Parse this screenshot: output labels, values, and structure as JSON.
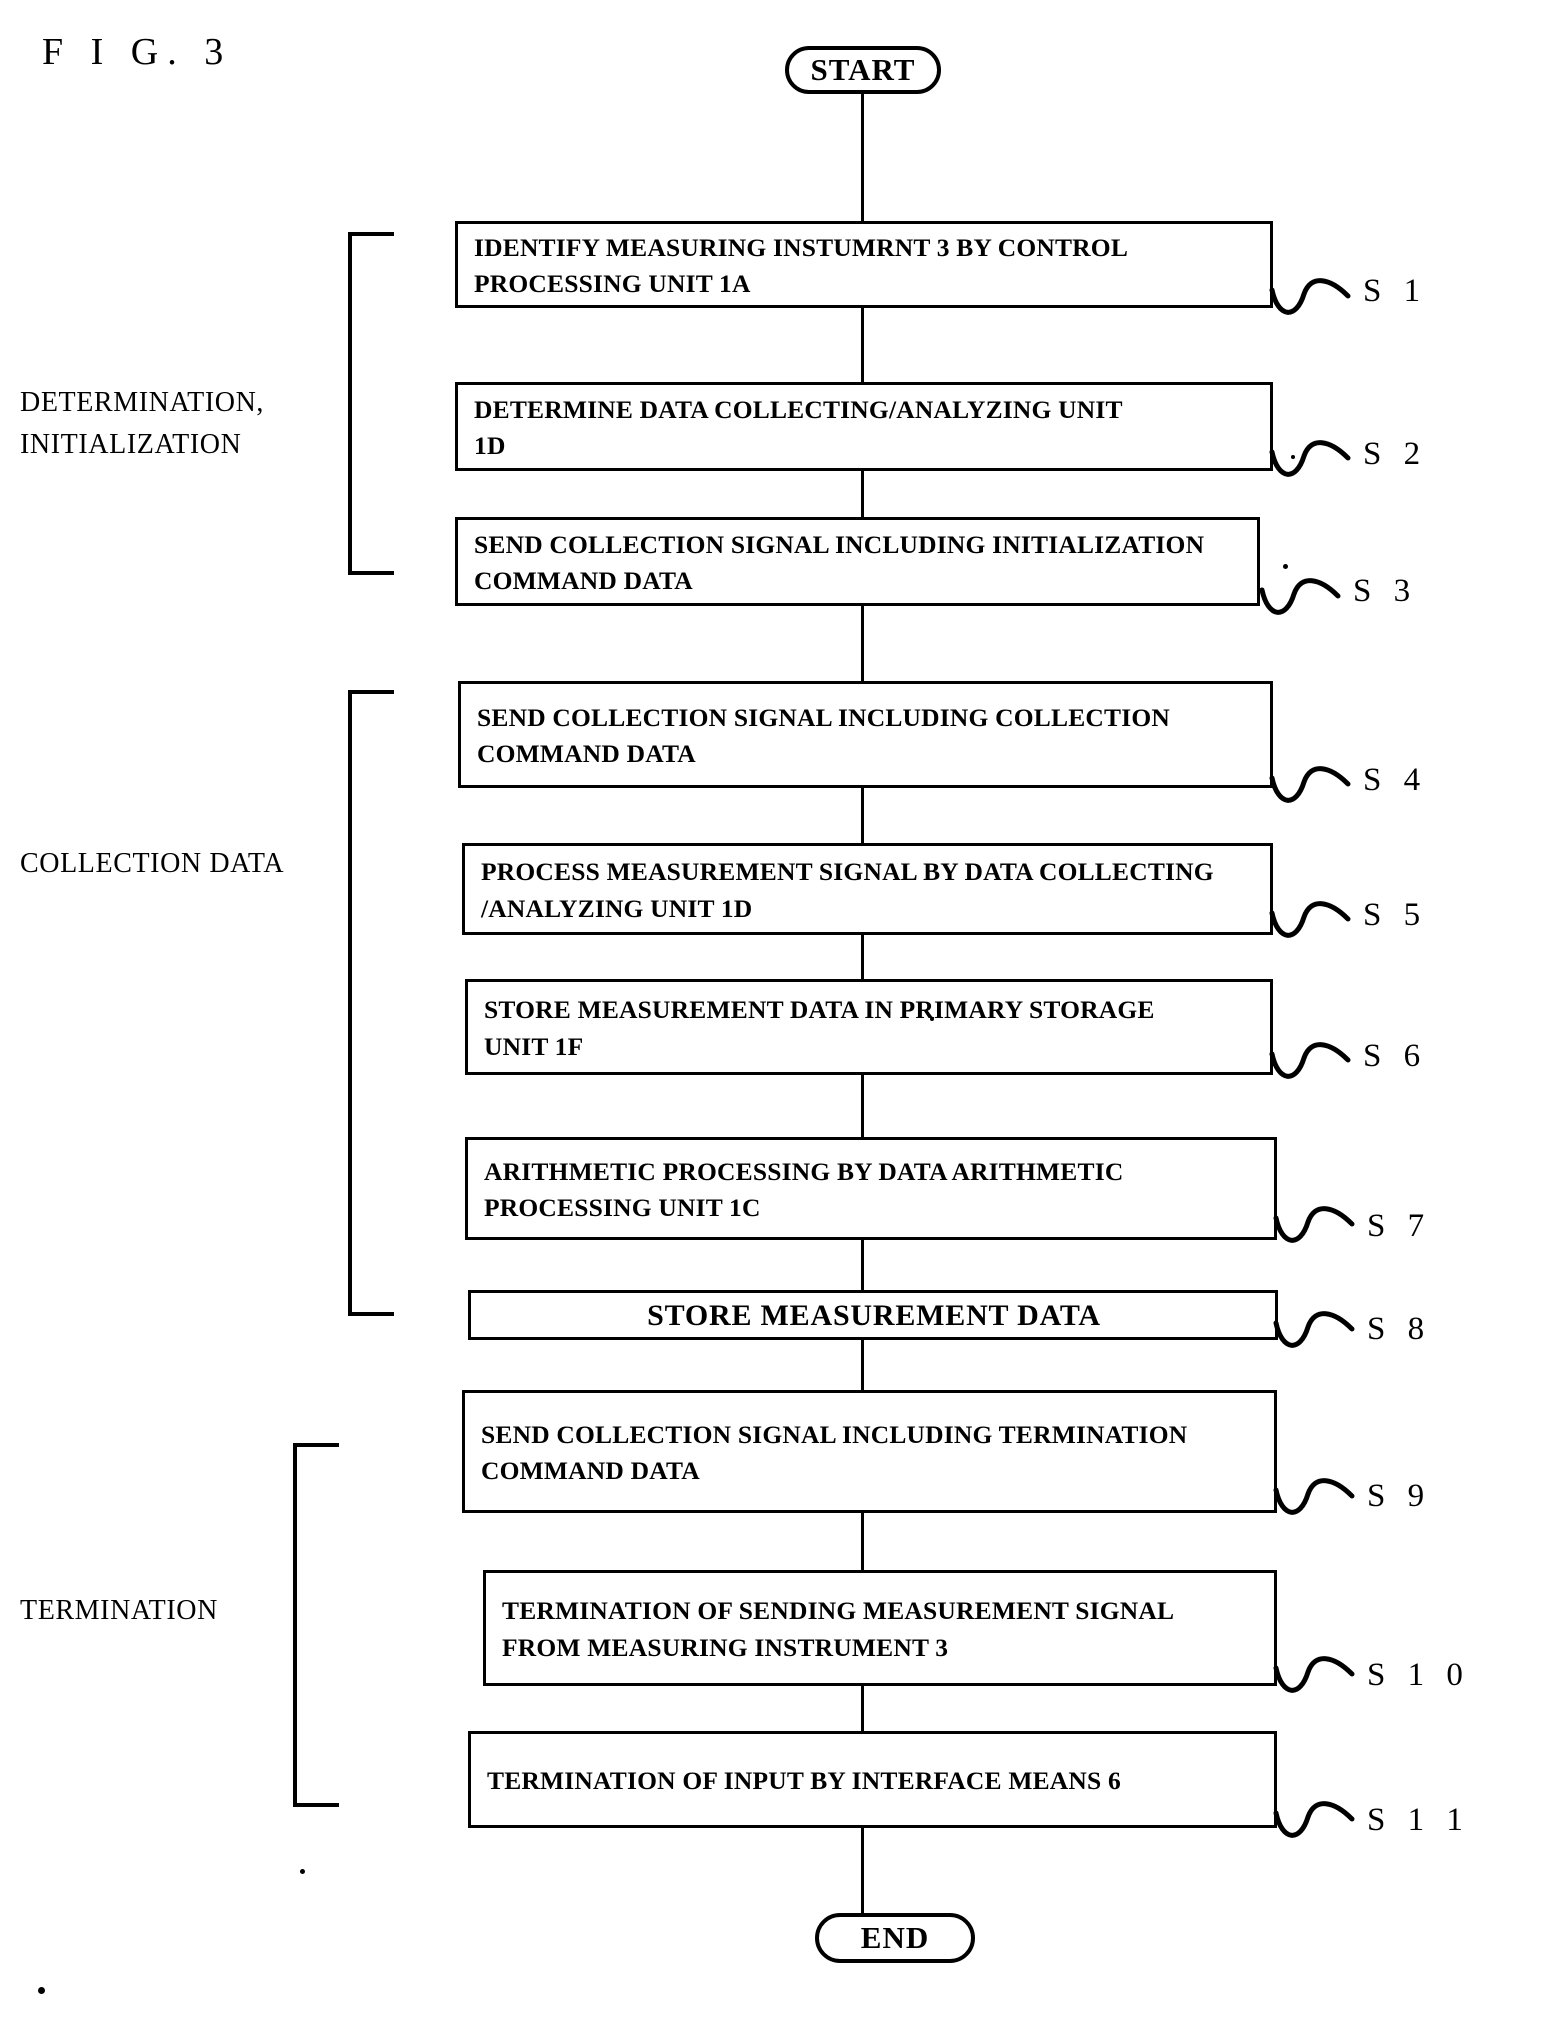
{
  "figure": {
    "label": "F I G.  3"
  },
  "terminals": {
    "start": "START",
    "end": "END"
  },
  "groups": [
    {
      "id": "determination",
      "label_line1": "DETERMINATION,",
      "label_line2": "INITIALIZATION"
    },
    {
      "id": "collection",
      "label_line1": "COLLECTION DATA",
      "label_line2": ""
    },
    {
      "id": "termination",
      "label_line1": "TERMINATION",
      "label_line2": ""
    }
  ],
  "steps": [
    {
      "id": "S1",
      "tag": "S 1",
      "lines": [
        "IDENTIFY MEASURING INSTUMRNT 3 BY CONTROL",
        "PROCESSING UNIT 1A"
      ],
      "align": "left"
    },
    {
      "id": "S2",
      "tag": "S 2",
      "lines": [
        "DETERMINE DATA COLLECTING/ANALYZING UNIT",
        "1D"
      ],
      "align": "left"
    },
    {
      "id": "S3",
      "tag": "S 3",
      "lines": [
        "SEND COLLECTION SIGNAL INCLUDING INITIALIZATION",
        "COMMAND DATA"
      ],
      "align": "left"
    },
    {
      "id": "S4",
      "tag": "S 4",
      "lines": [
        "SEND COLLECTION SIGNAL INCLUDING COLLECTION",
        "COMMAND DATA"
      ],
      "align": "left"
    },
    {
      "id": "S5",
      "tag": "S 5",
      "lines": [
        "PROCESS MEASUREMENT SIGNAL BY DATA COLLECTING",
        "/ANALYZING UNIT 1D"
      ],
      "align": "left"
    },
    {
      "id": "S6",
      "tag": "S 6",
      "lines": [
        "STORE MEASUREMENT DATA IN PRIMARY STORAGE",
        "UNIT 1F"
      ],
      "align": "left"
    },
    {
      "id": "S7",
      "tag": "S 7",
      "lines": [
        "ARITHMETIC PROCESSING BY DATA ARITHMETIC",
        "PROCESSING UNIT 1C"
      ],
      "align": "left"
    },
    {
      "id": "S8",
      "tag": "S 8",
      "lines": [
        "STORE MEASUREMENT DATA"
      ],
      "align": "center"
    },
    {
      "id": "S9",
      "tag": "S 9",
      "lines": [
        "SEND COLLECTION SIGNAL INCLUDING TERMINATION",
        "COMMAND DATA"
      ],
      "align": "left"
    },
    {
      "id": "S10",
      "tag": "S 1 0",
      "lines": [
        "TERMINATION OF SENDING MEASUREMENT SIGNAL",
        "FROM MEASURING INSTRUMENT 3"
      ],
      "align": "left"
    },
    {
      "id": "S11",
      "tag": "S 1 1",
      "lines": [
        "TERMINATION OF INPUT BY INTERFACE MEANS 6"
      ],
      "align": "left"
    }
  ],
  "colors": {
    "ink": "#000000",
    "paper": "#ffffff"
  }
}
